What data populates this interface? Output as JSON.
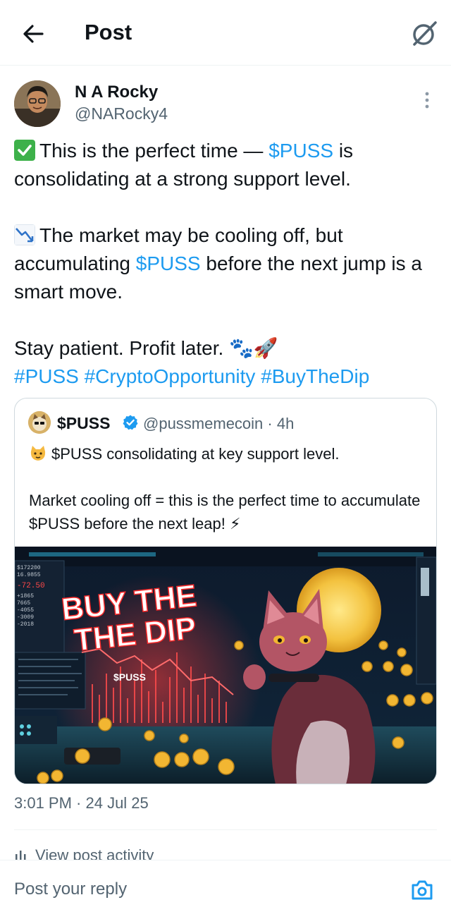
{
  "header": {
    "title": "Post"
  },
  "post": {
    "author_name": "N A Rocky",
    "author_handle": "@NARocky4",
    "p1": {
      "pre": "This is the perfect time — ",
      "cashtag": "$PUSS",
      "post": " is consolidating at a strong support level."
    },
    "p2": {
      "pre": "The market may be cooling off, but accumulating ",
      "cashtag": "$PUSS",
      "post": " before the next jump is a smart move."
    },
    "p3": {
      "text": "Stay patient. Profit later. 🐾🚀"
    },
    "hashtags": [
      "#PUSS",
      "#CryptoOpportunity",
      "#BuyTheDip"
    ],
    "timestamp": "3:01 PM · 24 Jul 25",
    "view_activity": "View post activity"
  },
  "quote": {
    "name": "$PUSS",
    "handle_time": "@pussmemecoin · 4h",
    "line1": "$PUSS consolidating at key support level.",
    "line2": "Market cooling off = this is the perfect time to accumulate $PUSS before the next leap! ⚡",
    "image_text": {
      "headline1": "BUY THE",
      "headline2": "THE DIP",
      "badge": "$PUSS",
      "ticker": [
        "$172200",
        "16.9855",
        "-72.50",
        "+1865",
        "7665",
        "-4055",
        "-3009",
        "-2018"
      ]
    }
  },
  "reply": {
    "placeholder": "Post your reply"
  },
  "icons": {
    "back": "arrow-left-icon",
    "grok": "grok-icon",
    "more": "more-vertical-icon",
    "verified": "verified-badge-icon",
    "activity": "bar-chart-icon",
    "camera": "camera-icon"
  },
  "colors": {
    "link": "#1d9bf0",
    "text": "#0f1419",
    "secondary": "#536471",
    "border": "#cfd9de"
  }
}
